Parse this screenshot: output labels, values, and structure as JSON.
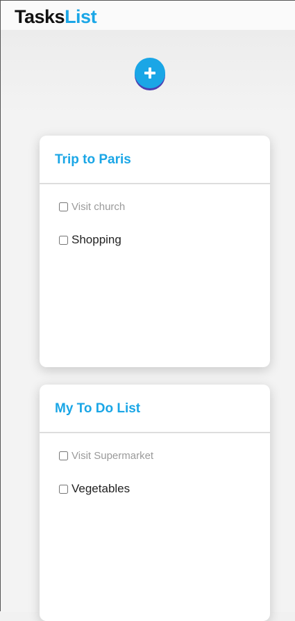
{
  "header": {
    "title_part1": "Tasks",
    "title_part2": "List"
  },
  "colors": {
    "accent": "#1aa6e6",
    "text": "#111111",
    "muted_task": "#9a9a9a"
  },
  "add_button": {
    "icon": "plus-icon"
  },
  "lists": [
    {
      "title": "Trip to Paris",
      "tasks": [
        {
          "label": "Visit church",
          "checked": false
        },
        {
          "label": "Shopping",
          "checked": false
        }
      ]
    },
    {
      "title": "My To Do List",
      "tasks": [
        {
          "label": "Visit Supermarket",
          "checked": false
        },
        {
          "label": "Vegetables",
          "checked": false
        }
      ]
    }
  ]
}
